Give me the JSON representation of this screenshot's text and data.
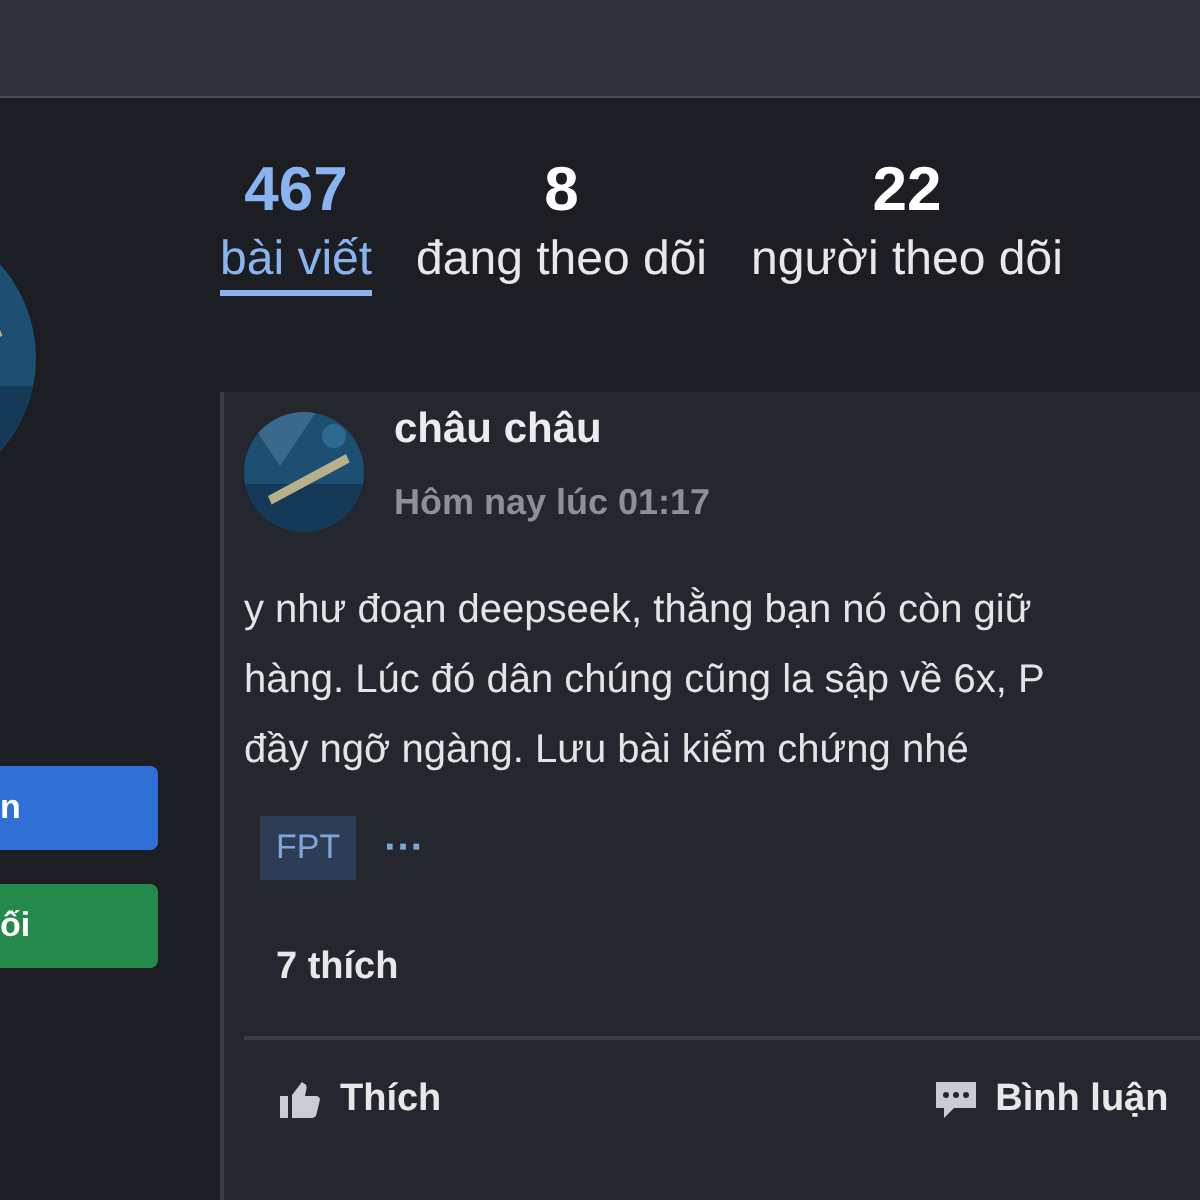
{
  "side_buttons": [
    {
      "label": "n",
      "kind": "primary"
    },
    {
      "label": "ối",
      "kind": "success"
    }
  ],
  "stats": [
    {
      "count": "467",
      "label": "bài viết",
      "selected": true
    },
    {
      "count": "8",
      "label": "đang theo dõi",
      "selected": false
    },
    {
      "count": "22",
      "label": "người theo dõi",
      "selected": false
    }
  ],
  "post": {
    "author": "châu châu",
    "time": "Hôm nay lúc 01:17",
    "body_lines": [
      "y như đoạn deepseek, thằng bạn nó còn giữ",
      "hàng. Lúc đó dân chúng cũng la sập về 6x, P",
      "đầy ngỡ ngàng. Lưu bài kiểm chứng nhé"
    ],
    "tags": [
      "FPT"
    ],
    "more": "···",
    "likes": "7 thích",
    "actions": [
      {
        "label": "Thích",
        "kind": "like"
      },
      {
        "label": "Bình luận",
        "kind": "comment"
      }
    ]
  }
}
